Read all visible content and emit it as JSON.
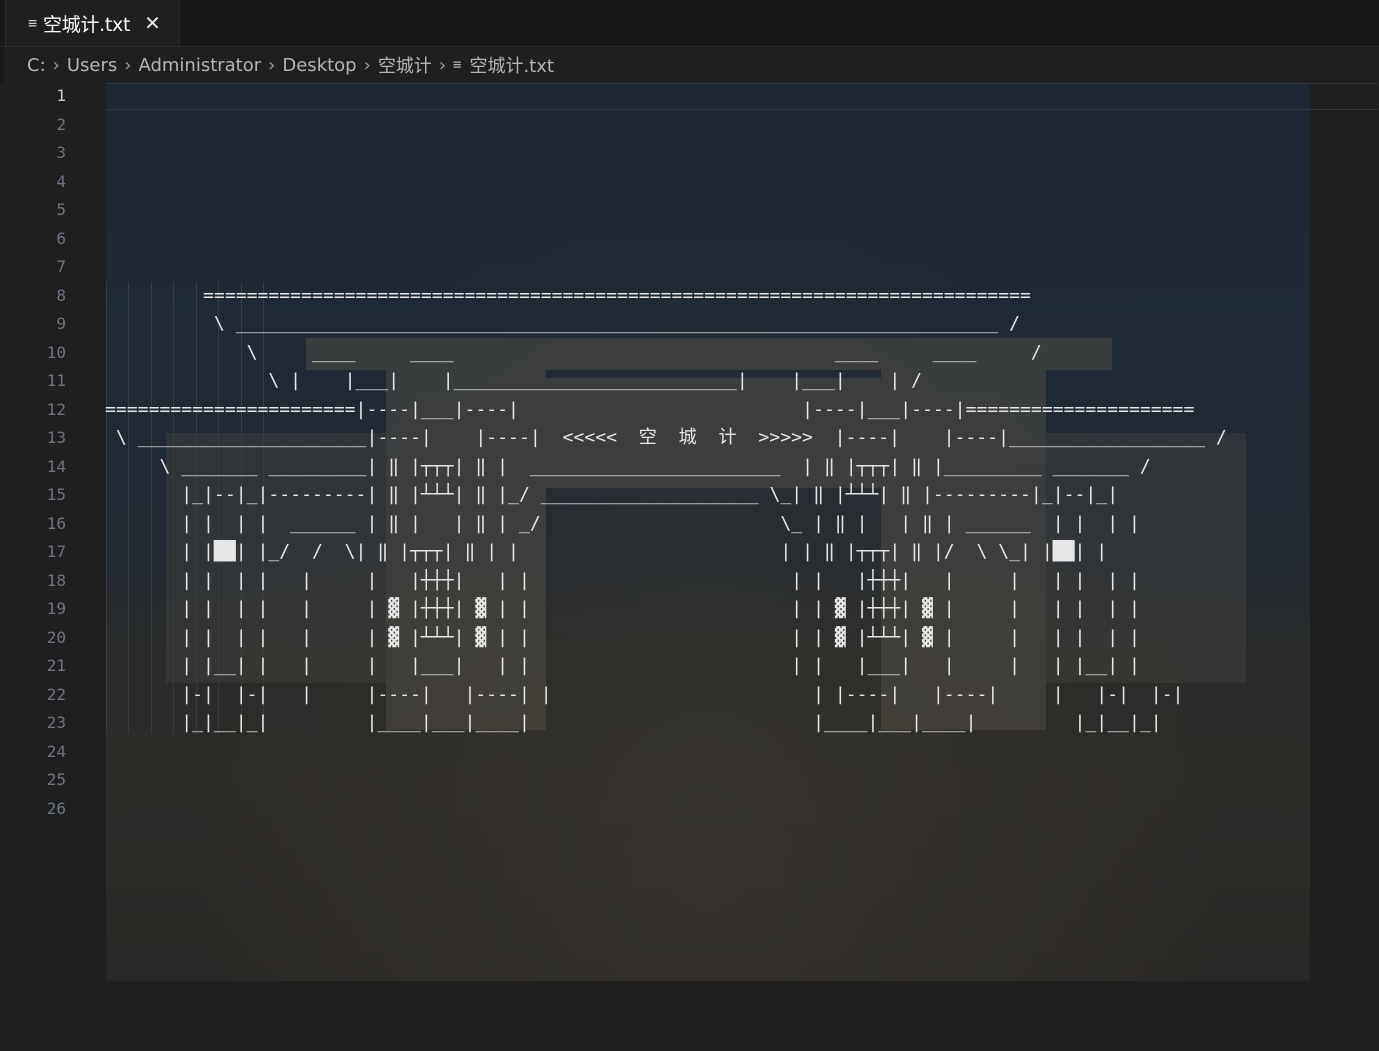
{
  "tab": {
    "icon": "file-text-icon",
    "label": "空城计.txt",
    "close_icon": "close-icon"
  },
  "breadcrumbs": {
    "items": [
      "C:",
      "Users",
      "Administrator",
      "Desktop",
      "空城计"
    ],
    "file": "空城计.txt",
    "separator": ">",
    "file_icon": "file-text-icon"
  },
  "editor": {
    "active_line": 1,
    "line_numbers": [
      "1",
      "2",
      "3",
      "4",
      "5",
      "6",
      "7",
      "8",
      "9",
      "10",
      "11",
      "12",
      "13",
      "14",
      "15",
      "16",
      "17",
      "18",
      "19",
      "20",
      "21",
      "22",
      "23",
      "24",
      "25",
      "26"
    ],
    "lines": [
      "",
      "",
      "",
      "",
      "",
      "",
      "",
      "         ============================================================================",
      "          \\ ______________________________________________________________________ /",
      "             \\     ____     ____                                   ____     ____     /",
      "               \\ |    |___|    |__________________________|    |___|    | /",
      "=======================|----|___|----|                          |----|___|----|=====================",
      " \\ _____________________|----|    |----|  <<<<<  空  城  计  >>>>>  |----|    |----|__________________ /",
      "     \\ _______ _________| ‖ |┬┬┬| ‖ |  _______________________  | ‖ |┬┬┬| ‖ |_________ _______ /",
      "       |_|--|_|---------| ‖ |┴┴┴| ‖ |_/ ____________________ \\_| ‖ |┴┴┴| ‖ |---------|_|--|_|",
      "       | |  | |  ______ | ‖ |   | ‖ | _/                      \\_ | ‖ |   | ‖ | ______  | |  | |",
      "       | |██| |_/  /  \\| ‖ |┬┬┬| ‖ | |                        | | ‖ |┬┬┬| ‖ |/  \\ \\_| |██| |",
      "       | |  | |   |     |   |┼┼┼|   | |                        | |   |┼┼┼|   |     |   | |  | |",
      "       | |  | |   |     | ▓ |┼┼┼| ▓ | |                        | | ▓ |┼┼┼| ▓ |     |   | |  | |",
      "       | |  | |   |     | ▓ |┴┴┴| ▓ | |                        | | ▓ |┴┴┴| ▓ |     |   | |  | |",
      "       | |__| |   |     |   |___|   | |                        | |   |___|   |     |   | |__| |",
      "       |-|  |-|   |     |----|   |----| |                        | |----|   |----|     |   |-|  |-|",
      "       |_|__|_|         |____|___|____|                          |____|___|____|         |_|__|_|",
      "",
      "",
      ""
    ]
  },
  "colors": {
    "editor_bg": "#1f1f1f",
    "tabbar_bg": "#181818",
    "text": "#e6e6e6",
    "line_number": "#6e7681",
    "line_number_active": "#cccccc"
  }
}
